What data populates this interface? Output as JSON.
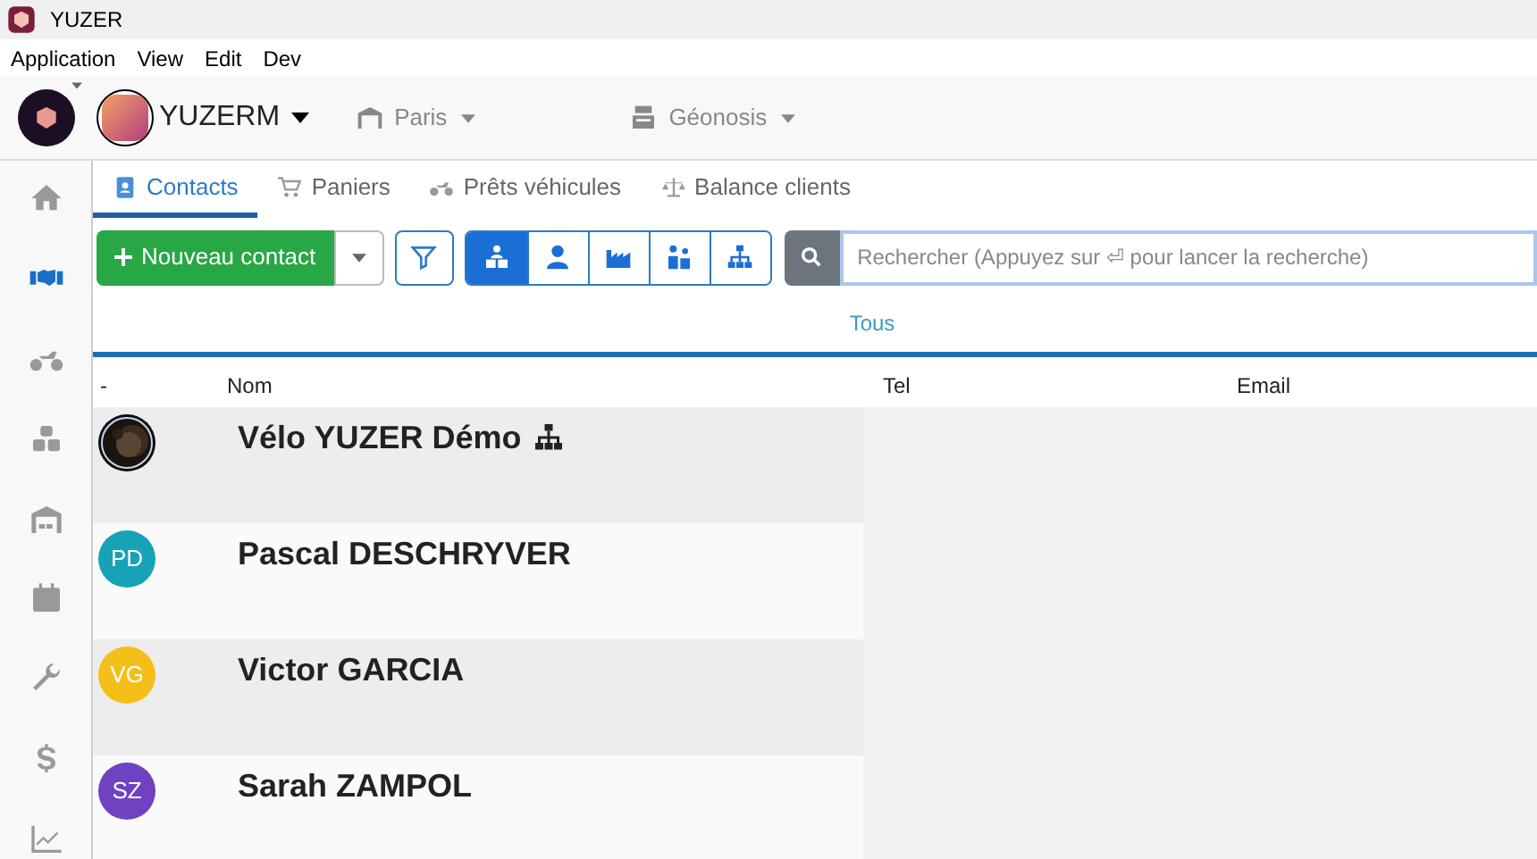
{
  "window": {
    "title": "YUZER"
  },
  "menu": [
    "Application",
    "View",
    "Edit",
    "Dev"
  ],
  "toolbar": {
    "account": "YUZERM",
    "store": "Paris",
    "warehouse": "Géonosis"
  },
  "sidebar": [
    {
      "selected": false
    },
    {
      "selected": true
    },
    {
      "selected": false
    },
    {
      "selected": false
    },
    {
      "selected": false
    },
    {
      "selected": false
    },
    {
      "selected": false
    },
    {
      "selected": false
    },
    {
      "selected": false
    }
  ],
  "tabs": [
    {
      "label": "Contacts",
      "selected": true
    },
    {
      "label": "Paniers",
      "selected": false
    },
    {
      "label": "Prêts véhicules",
      "selected": false
    },
    {
      "label": "Balance clients",
      "selected": false
    }
  ],
  "actions": {
    "new_button": "Nouveau contact",
    "filters": [
      {
        "selected": true
      },
      {
        "selected": false
      },
      {
        "selected": false
      },
      {
        "selected": false
      },
      {
        "selected": false
      }
    ],
    "search": {
      "placeholder": "Rechercher (Appuyez sur ⏎ pour lancer la recherche)"
    }
  },
  "segment": {
    "label": "Tous"
  },
  "table": {
    "columns": [
      "-",
      "Nom",
      "Tel",
      "Email"
    ],
    "rows": [
      {
        "name": "Vélo YUZER Démo",
        "group": true
      },
      {
        "name": "Pascal DESCHRYVER",
        "avatar": {
          "kind": "initials",
          "initials": "PD",
          "color": "#17a2b8"
        },
        "group": false
      },
      {
        "name": "Victor GARCIA",
        "avatar": {
          "kind": "initials",
          "initials": "VG",
          "color": "#f5bf1a"
        },
        "group": false
      },
      {
        "name": "Sarah ZAMPOL",
        "avatar": {
          "kind": "initials",
          "initials": "SZ",
          "color": "#6f42c1"
        },
        "group": false
      }
    ]
  }
}
